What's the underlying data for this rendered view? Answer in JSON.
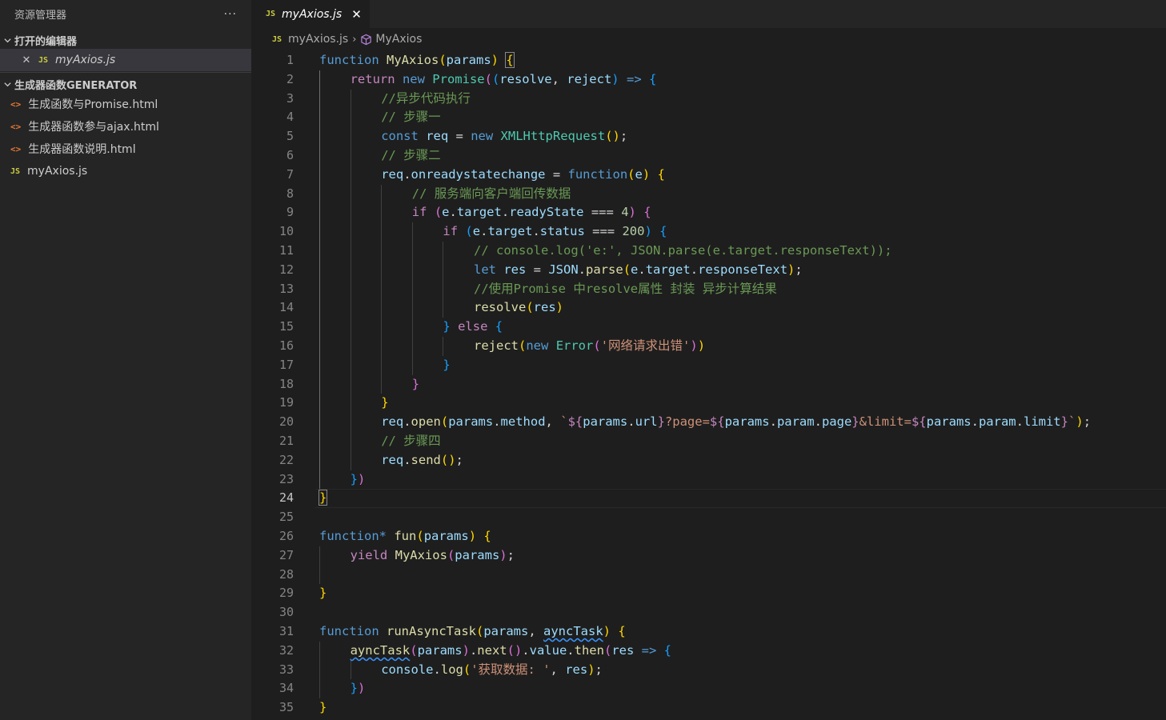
{
  "sidebar": {
    "title": "资源管理器",
    "more": "···",
    "open_editors": {
      "header": "打开的编辑器",
      "items": [
        {
          "close": "✕",
          "badge": "JS",
          "label": "myAxios.js"
        }
      ]
    },
    "folder": {
      "header": "生成器函数GENERATOR",
      "files": [
        {
          "badge": "<>",
          "label": "生成函数与Promise.html"
        },
        {
          "badge": "<>",
          "label": "生成器函数参与ajax.html"
        },
        {
          "badge": "<>",
          "label": "生成器函数说明.html"
        },
        {
          "badge": "JS",
          "label": "myAxios.js"
        }
      ]
    }
  },
  "editor": {
    "tab": {
      "badge": "JS",
      "label": "myAxios.js",
      "close": "✕"
    },
    "breadcrumb": {
      "badge": "JS",
      "file": "myAxios.js",
      "sep": "›",
      "symbol": "MyAxios"
    },
    "current_line": 24,
    "colors": {
      "keyword": "#569cd6",
      "control": "#c586c0",
      "function": "#dcdcaa",
      "variable": "#9cdcfe",
      "class": "#4ec9b0",
      "string": "#ce9178",
      "number": "#b5cea8",
      "comment": "#6a9955"
    },
    "lines": [
      {
        "n": "1",
        "indent": 0,
        "tokens": [
          [
            "kw",
            "function"
          ],
          [
            "p",
            " "
          ],
          [
            "fn",
            "MyAxios"
          ],
          [
            "b1",
            "("
          ],
          [
            "var",
            "params"
          ],
          [
            "b1",
            ")"
          ],
          [
            "p",
            " "
          ],
          [
            "b1m",
            "{"
          ]
        ]
      },
      {
        "n": "2",
        "indent": 1,
        "tokens": [
          [
            "ctl",
            "return"
          ],
          [
            "p",
            " "
          ],
          [
            "kw",
            "new"
          ],
          [
            "p",
            " "
          ],
          [
            "cls",
            "Promise"
          ],
          [
            "b2",
            "("
          ],
          [
            "b3",
            "("
          ],
          [
            "var",
            "resolve"
          ],
          [
            "p",
            ", "
          ],
          [
            "var",
            "reject"
          ],
          [
            "b3",
            ")"
          ],
          [
            "p",
            " "
          ],
          [
            "kw",
            "=>"
          ],
          [
            "p",
            " "
          ],
          [
            "b3",
            "{"
          ]
        ]
      },
      {
        "n": "3",
        "indent": 2,
        "tokens": [
          [
            "com",
            "//异步代码执行"
          ]
        ]
      },
      {
        "n": "4",
        "indent": 2,
        "tokens": [
          [
            "com",
            "// 步骤一"
          ]
        ]
      },
      {
        "n": "5",
        "indent": 2,
        "tokens": [
          [
            "kw",
            "const"
          ],
          [
            "p",
            " "
          ],
          [
            "var",
            "req"
          ],
          [
            "p",
            " = "
          ],
          [
            "kw",
            "new"
          ],
          [
            "p",
            " "
          ],
          [
            "cls",
            "XMLHttpRequest"
          ],
          [
            "b1",
            "()"
          ],
          [
            "p",
            ";"
          ]
        ]
      },
      {
        "n": "6",
        "indent": 2,
        "tokens": [
          [
            "com",
            "// 步骤二"
          ]
        ]
      },
      {
        "n": "7",
        "indent": 2,
        "tokens": [
          [
            "var",
            "req"
          ],
          [
            "p",
            "."
          ],
          [
            "var",
            "onreadystatechange"
          ],
          [
            "p",
            " = "
          ],
          [
            "kw",
            "function"
          ],
          [
            "b1",
            "("
          ],
          [
            "var",
            "e"
          ],
          [
            "b1",
            ")"
          ],
          [
            "p",
            " "
          ],
          [
            "b1",
            "{"
          ]
        ]
      },
      {
        "n": "8",
        "indent": 3,
        "tokens": [
          [
            "com",
            "// 服务端向客户端回传数据"
          ]
        ]
      },
      {
        "n": "9",
        "indent": 3,
        "tokens": [
          [
            "ctl",
            "if"
          ],
          [
            "p",
            " "
          ],
          [
            "b2",
            "("
          ],
          [
            "var",
            "e"
          ],
          [
            "p",
            "."
          ],
          [
            "var",
            "target"
          ],
          [
            "p",
            "."
          ],
          [
            "var",
            "readyState"
          ],
          [
            "p",
            " === "
          ],
          [
            "num",
            "4"
          ],
          [
            "b2",
            ")"
          ],
          [
            "p",
            " "
          ],
          [
            "b2",
            "{"
          ]
        ]
      },
      {
        "n": "10",
        "indent": 4,
        "tokens": [
          [
            "ctl",
            "if"
          ],
          [
            "p",
            " "
          ],
          [
            "b3",
            "("
          ],
          [
            "var",
            "e"
          ],
          [
            "p",
            "."
          ],
          [
            "var",
            "target"
          ],
          [
            "p",
            "."
          ],
          [
            "var",
            "status"
          ],
          [
            "p",
            " === "
          ],
          [
            "num",
            "200"
          ],
          [
            "b3",
            ")"
          ],
          [
            "p",
            " "
          ],
          [
            "b3",
            "{"
          ]
        ]
      },
      {
        "n": "11",
        "indent": 5,
        "tokens": [
          [
            "com",
            "// console.log('e:', JSON.parse(e.target.responseText));"
          ]
        ]
      },
      {
        "n": "12",
        "indent": 5,
        "tokens": [
          [
            "kw",
            "let"
          ],
          [
            "p",
            " "
          ],
          [
            "var",
            "res"
          ],
          [
            "p",
            " = "
          ],
          [
            "var",
            "JSON"
          ],
          [
            "p",
            "."
          ],
          [
            "fn",
            "parse"
          ],
          [
            "b1",
            "("
          ],
          [
            "var",
            "e"
          ],
          [
            "p",
            "."
          ],
          [
            "var",
            "target"
          ],
          [
            "p",
            "."
          ],
          [
            "var",
            "responseText"
          ],
          [
            "b1",
            ")"
          ],
          [
            "p",
            ";"
          ]
        ]
      },
      {
        "n": "13",
        "indent": 5,
        "tokens": [
          [
            "com",
            "//使用Promise 中resolve属性 封装 异步计算结果"
          ]
        ]
      },
      {
        "n": "14",
        "indent": 5,
        "tokens": [
          [
            "fn",
            "resolve"
          ],
          [
            "b1",
            "("
          ],
          [
            "var",
            "res"
          ],
          [
            "b1",
            ")"
          ]
        ]
      },
      {
        "n": "15",
        "indent": 4,
        "tokens": [
          [
            "b3",
            "}"
          ],
          [
            "p",
            " "
          ],
          [
            "ctl",
            "else"
          ],
          [
            "p",
            " "
          ],
          [
            "b3",
            "{"
          ]
        ]
      },
      {
        "n": "16",
        "indent": 5,
        "tokens": [
          [
            "fn",
            "reject"
          ],
          [
            "b1",
            "("
          ],
          [
            "kw",
            "new"
          ],
          [
            "p",
            " "
          ],
          [
            "cls",
            "Error"
          ],
          [
            "b2",
            "("
          ],
          [
            "str",
            "'网络请求出错'"
          ],
          [
            "b2",
            ")"
          ],
          [
            "b1",
            ")"
          ]
        ]
      },
      {
        "n": "17",
        "indent": 4,
        "tokens": [
          [
            "b3",
            "}"
          ]
        ]
      },
      {
        "n": "18",
        "indent": 3,
        "tokens": [
          [
            "b2",
            "}"
          ]
        ]
      },
      {
        "n": "19",
        "indent": 2,
        "tokens": [
          [
            "b1",
            "}"
          ]
        ]
      },
      {
        "n": "20",
        "indent": 2,
        "tokens": [
          [
            "var",
            "req"
          ],
          [
            "p",
            "."
          ],
          [
            "fn",
            "open"
          ],
          [
            "b1",
            "("
          ],
          [
            "var",
            "params"
          ],
          [
            "p",
            "."
          ],
          [
            "var",
            "method"
          ],
          [
            "p",
            ", "
          ],
          [
            "str",
            "`"
          ],
          [
            "ctl",
            "${"
          ],
          [
            "var",
            "params"
          ],
          [
            "p",
            "."
          ],
          [
            "var",
            "url"
          ],
          [
            "ctl",
            "}"
          ],
          [
            "str",
            "?page="
          ],
          [
            "ctl",
            "${"
          ],
          [
            "var",
            "params"
          ],
          [
            "p",
            "."
          ],
          [
            "var",
            "param"
          ],
          [
            "p",
            "."
          ],
          [
            "var",
            "page"
          ],
          [
            "ctl",
            "}"
          ],
          [
            "str",
            "&limit="
          ],
          [
            "ctl",
            "${"
          ],
          [
            "var",
            "params"
          ],
          [
            "p",
            "."
          ],
          [
            "var",
            "param"
          ],
          [
            "p",
            "."
          ],
          [
            "var",
            "limit"
          ],
          [
            "ctl",
            "}"
          ],
          [
            "str",
            "`"
          ],
          [
            "b1",
            ")"
          ],
          [
            "p",
            ";"
          ]
        ]
      },
      {
        "n": "21",
        "indent": 2,
        "tokens": [
          [
            "com",
            "// 步骤四"
          ]
        ]
      },
      {
        "n": "22",
        "indent": 2,
        "tokens": [
          [
            "var",
            "req"
          ],
          [
            "p",
            "."
          ],
          [
            "fn",
            "send"
          ],
          [
            "b1",
            "()"
          ],
          [
            "p",
            ";"
          ]
        ]
      },
      {
        "n": "23",
        "indent": 1,
        "tokens": [
          [
            "b3",
            "}"
          ],
          [
            "b2",
            ")"
          ]
        ]
      },
      {
        "n": "24",
        "indent": 0,
        "tokens": [
          [
            "b1m",
            "}"
          ]
        ]
      },
      {
        "n": "25",
        "indent": 0,
        "tokens": []
      },
      {
        "n": "26",
        "indent": 0,
        "tokens": [
          [
            "kw",
            "function*"
          ],
          [
            "p",
            " "
          ],
          [
            "fn",
            "fun"
          ],
          [
            "b1",
            "("
          ],
          [
            "var",
            "params"
          ],
          [
            "b1",
            ")"
          ],
          [
            "p",
            " "
          ],
          [
            "b1",
            "{"
          ]
        ]
      },
      {
        "n": "27",
        "indent": 1,
        "tokens": [
          [
            "ctl",
            "yield"
          ],
          [
            "p",
            " "
          ],
          [
            "fn",
            "MyAxios"
          ],
          [
            "b2",
            "("
          ],
          [
            "var",
            "params"
          ],
          [
            "b2",
            ")"
          ],
          [
            "p",
            ";"
          ]
        ]
      },
      {
        "n": "28",
        "indent": 0,
        "tokens": []
      },
      {
        "n": "29",
        "indent": 0,
        "tokens": [
          [
            "b1",
            "}"
          ]
        ]
      },
      {
        "n": "30",
        "indent": 0,
        "tokens": []
      },
      {
        "n": "31",
        "indent": 0,
        "tokens": [
          [
            "kw",
            "function"
          ],
          [
            "p",
            " "
          ],
          [
            "fn",
            "runAsyncTask"
          ],
          [
            "b1",
            "("
          ],
          [
            "var",
            "params"
          ],
          [
            "p",
            ", "
          ],
          [
            "varw",
            "ayncTask"
          ],
          [
            "b1",
            ")"
          ],
          [
            "p",
            " "
          ],
          [
            "b1",
            "{"
          ]
        ]
      },
      {
        "n": "32",
        "indent": 1,
        "tokens": [
          [
            "fnw",
            "ayncTask"
          ],
          [
            "b2",
            "("
          ],
          [
            "var",
            "params"
          ],
          [
            "b2",
            ")"
          ],
          [
            "p",
            "."
          ],
          [
            "fn",
            "next"
          ],
          [
            "b2",
            "()"
          ],
          [
            "p",
            "."
          ],
          [
            "var",
            "value"
          ],
          [
            "p",
            "."
          ],
          [
            "fn",
            "then"
          ],
          [
            "b2",
            "("
          ],
          [
            "var",
            "res"
          ],
          [
            "p",
            " "
          ],
          [
            "kw",
            "=>"
          ],
          [
            "p",
            " "
          ],
          [
            "b3",
            "{"
          ]
        ]
      },
      {
        "n": "33",
        "indent": 2,
        "tokens": [
          [
            "var",
            "console"
          ],
          [
            "p",
            "."
          ],
          [
            "fn",
            "log"
          ],
          [
            "b1",
            "("
          ],
          [
            "str",
            "'获取数据: '"
          ],
          [
            "p",
            ", "
          ],
          [
            "var",
            "res"
          ],
          [
            "b1",
            ")"
          ],
          [
            "p",
            ";"
          ]
        ]
      },
      {
        "n": "34",
        "indent": 1,
        "tokens": [
          [
            "b3",
            "}"
          ],
          [
            "b2",
            ")"
          ]
        ]
      },
      {
        "n": "35",
        "indent": 0,
        "tokens": [
          [
            "b1",
            "}"
          ]
        ]
      }
    ]
  }
}
